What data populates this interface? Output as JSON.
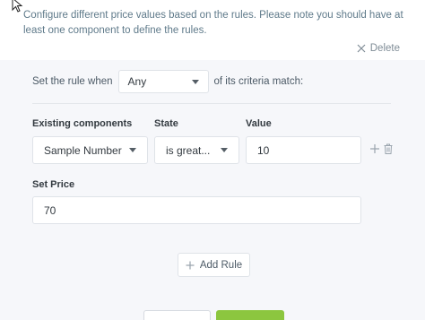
{
  "description": "Configure different price values based on the rules. Please note you should have at least one component to define the rules.",
  "delete_label": "Delete",
  "rule": {
    "prefix": "Set the rule when",
    "match_value": "Any",
    "suffix": "of its criteria match:"
  },
  "columns": {
    "component": "Existing components",
    "state": "State",
    "value": "Value"
  },
  "criteria": {
    "component": "Sample Number",
    "state": "is great...",
    "value": "10"
  },
  "set_price": {
    "label": "Set Price",
    "value": "70"
  },
  "add_rule_label": "Add Rule",
  "colors": {
    "save_button": "#8cc63f",
    "panel_bg": "#f6f7fa",
    "description_text": "#5f7a8a"
  }
}
